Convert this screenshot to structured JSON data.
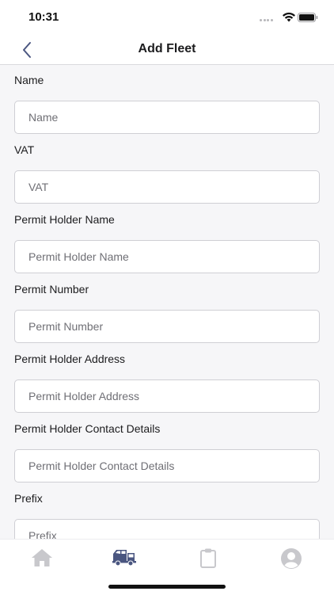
{
  "status_bar": {
    "time": "10:31"
  },
  "header": {
    "title": "Add Fleet",
    "back_icon": "chevron-left-icon"
  },
  "form": {
    "fields": [
      {
        "label": "Name",
        "placeholder": "Name",
        "value": ""
      },
      {
        "label": "VAT",
        "placeholder": "VAT",
        "value": ""
      },
      {
        "label": "Permit Holder Name",
        "placeholder": "Permit Holder Name",
        "value": ""
      },
      {
        "label": "Permit Number",
        "placeholder": "Permit Number",
        "value": ""
      },
      {
        "label": "Permit Holder Address",
        "placeholder": "Permit Holder Address",
        "value": ""
      },
      {
        "label": "Permit Holder Contact Details",
        "placeholder": "Permit Holder Contact Details",
        "value": ""
      },
      {
        "label": "Prefix",
        "placeholder": "Prefix",
        "value": ""
      }
    ]
  },
  "tab_bar": {
    "tabs": [
      {
        "icon": "home-icon",
        "active": false
      },
      {
        "icon": "truck-icon",
        "active": true
      },
      {
        "icon": "clipboard-icon",
        "active": false
      },
      {
        "icon": "profile-icon",
        "active": false
      }
    ],
    "active_color": "#4a5680",
    "inactive_color": "#c8c8cc"
  }
}
